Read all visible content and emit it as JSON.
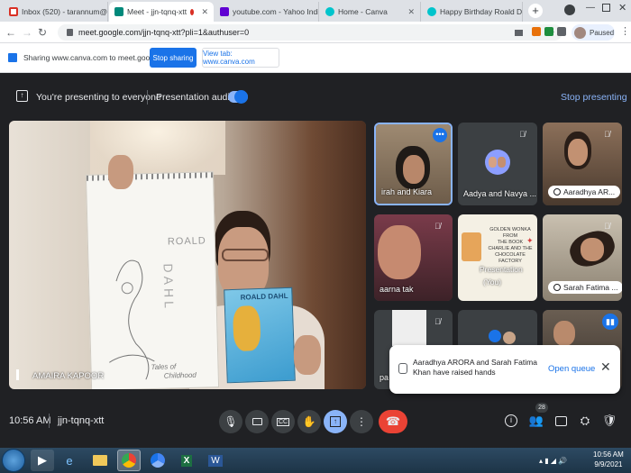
{
  "tabs": [
    {
      "label": "Inbox (520) - tarannum@thei",
      "fav": "#d93025",
      "icon": "gmail-icon"
    },
    {
      "label": "Meet - jjn-tqnq-xtt",
      "fav": "#00897b",
      "icon": "meet-icon"
    },
    {
      "label": "youtube.com - Yahoo India Se",
      "fav": "#6001d2",
      "icon": "yahoo-icon"
    },
    {
      "label": "Home - Canva",
      "fav": "#00c4cc",
      "icon": "canva-icon"
    },
    {
      "label": "Happy Birthday Roald Dal",
      "fav": "#00c4cc",
      "icon": "canva-icon"
    }
  ],
  "address": {
    "url": "meet.google.com/jjn-tqnq-xtt?pli=1&authuser=0",
    "profile_status": "Paused"
  },
  "sharing": {
    "text": "Sharing www.canva.com to meet.google.com",
    "stop_label": "Stop sharing",
    "view_label": "View tab: www.canva.com"
  },
  "presenting": {
    "text": "You're presenting to everyone",
    "audio_label": "Presentation audio",
    "stop_label": "Stop presenting"
  },
  "main_speaker": {
    "name": "AMAIRA KAPOOR",
    "sketch_text": [
      "ROALD",
      "DAHL",
      "Tales of",
      "Childhood"
    ],
    "book_text": "ROALD DAHL"
  },
  "participants": [
    {
      "name": "irah and Kiara",
      "bg": "#8a7a66"
    },
    {
      "name": "Aadya and Navya ...",
      "bg": "#3c4043"
    },
    {
      "name": "Aaradhya AR...",
      "bg": "#6b5545"
    },
    {
      "name": "aarna tak",
      "bg": "#6b3040"
    },
    {
      "name": "Presentation",
      "bg": "#f2efe6",
      "slide_text": [
        "GOLDEN WONKA",
        "FROM",
        "THE BOOK",
        "CHARLIE AND THE",
        "CHOCOLATE",
        "FACTORY"
      ],
      "badge": "(You)"
    },
    {
      "name": "Sarah Fatima ...",
      "bg": "#b8ad99"
    },
    {
      "name": "pa",
      "bg": "#4a4a4a"
    },
    {
      "name": "",
      "bg": "#3c4043"
    },
    {
      "name": "",
      "bg": "#5a5048"
    }
  ],
  "toast": {
    "text": "Aaradhya ARORA and Sarah Fatima Khan have raised hands",
    "action": "Open queue"
  },
  "controls": {
    "time": "10:56 AM",
    "meeting_code": "jjn-tqnq-xtt",
    "participant_count": "28"
  },
  "taskbar": {
    "time": "10:56 AM",
    "date": "9/9/2021"
  }
}
